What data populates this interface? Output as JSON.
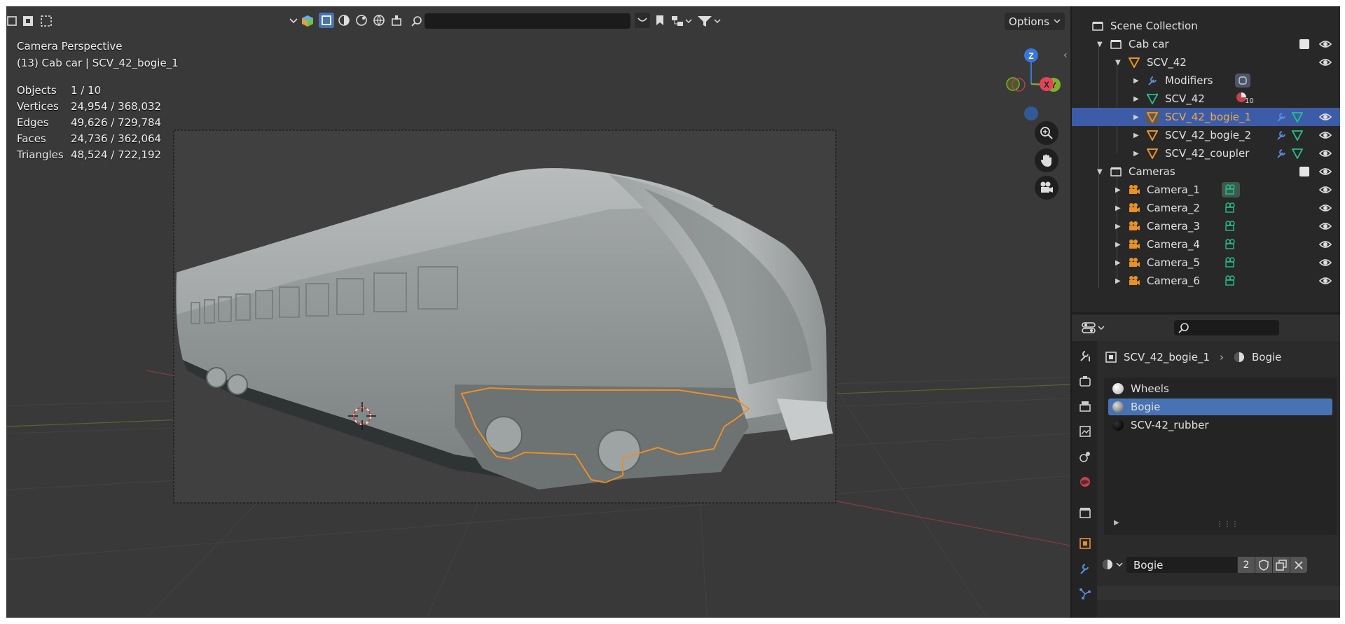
{
  "viewport": {
    "overlay": {
      "view_name": "Camera Perspective",
      "active_object": "(13) Cab car | SCV_42_bogie_1"
    },
    "stats": [
      {
        "label": "Objects",
        "value": "1 / 10"
      },
      {
        "label": "Vertices",
        "value": "24,954 / 368,032"
      },
      {
        "label": "Edges",
        "value": "49,626 / 729,784"
      },
      {
        "label": "Faces",
        "value": "24,736 / 362,064"
      },
      {
        "label": "Triangles",
        "value": "48,524 / 722,192"
      }
    ],
    "header": {
      "options_label": "Options",
      "search_placeholder": ""
    },
    "gizmo": {
      "z": "Z",
      "x": "X",
      "y": "Y"
    },
    "colors": {
      "background": "#393939",
      "selection_outline": "#e8902a",
      "x_axis": "#e2455a",
      "y_axis": "#7fb02c",
      "z_axis": "#3a76d8"
    }
  },
  "outliner": {
    "rows": [
      {
        "label": "Scene Collection",
        "icon": "scene-collection-icon"
      },
      {
        "label": "Cab car",
        "icon": "collection-icon"
      },
      {
        "label": "SCV_42",
        "icon": "mesh-object-icon"
      },
      {
        "label": "Modifiers",
        "icon": "wrench-icon"
      },
      {
        "label": "SCV_42",
        "icon": "mesh-data-icon",
        "badge": "10"
      },
      {
        "label": "SCV_42_bogie_1",
        "icon": "mesh-object-icon",
        "selected": true
      },
      {
        "label": "SCV_42_bogie_2",
        "icon": "mesh-object-icon"
      },
      {
        "label": "SCV_42_coupler",
        "icon": "mesh-object-icon"
      },
      {
        "label": "Cameras",
        "icon": "collection-icon"
      },
      {
        "label": "Camera_1",
        "icon": "camera-object-icon"
      },
      {
        "label": "Camera_2",
        "icon": "camera-object-icon"
      },
      {
        "label": "Camera_3",
        "icon": "camera-object-icon"
      },
      {
        "label": "Camera_4",
        "icon": "camera-object-icon"
      },
      {
        "label": "Camera_5",
        "icon": "camera-object-icon"
      },
      {
        "label": "Camera_6",
        "icon": "camera-object-icon"
      }
    ]
  },
  "properties": {
    "search_placeholder": "",
    "breadcrumb": {
      "object": "SCV_42_bogie_1",
      "material": "Bogie"
    },
    "material_slots": [
      {
        "name": "Wheels",
        "color": "#e8e8e8"
      },
      {
        "name": "Bogie",
        "color": "#9a9a9a",
        "selected": true
      },
      {
        "name": "SCV-42_rubber",
        "color": "#111111"
      }
    ],
    "material": {
      "name": "Bogie",
      "users": "2"
    }
  }
}
